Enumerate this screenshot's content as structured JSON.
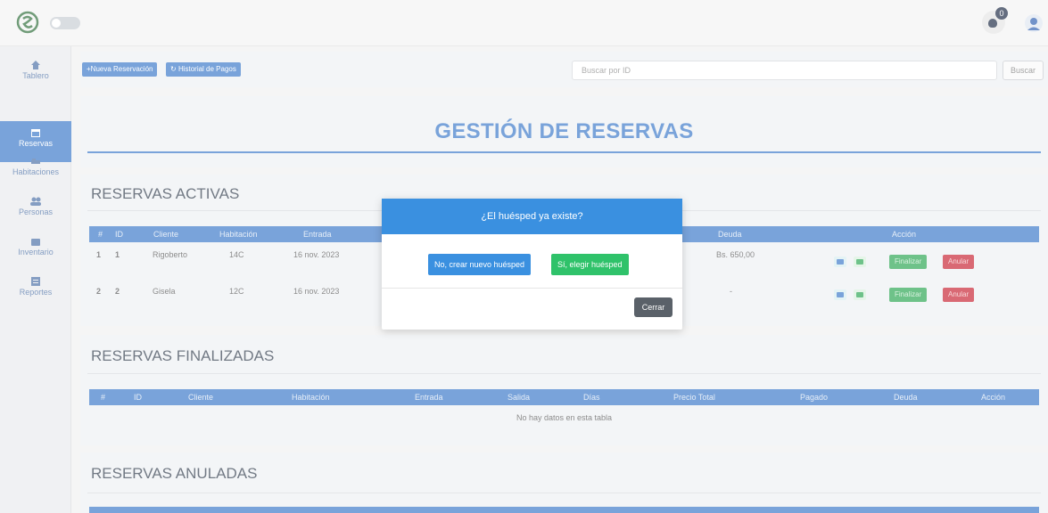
{
  "topbar": {
    "notification_count": "0"
  },
  "sidebar": {
    "items": [
      {
        "label": "Tablero",
        "icon": "home-icon",
        "active": false
      },
      {
        "label": "Reservas",
        "icon": "calendar-icon",
        "active": true
      },
      {
        "label": "Habitaciones",
        "icon": "bed-icon",
        "active": false
      },
      {
        "label": "Personas",
        "icon": "users-icon",
        "active": false
      },
      {
        "label": "Inventario",
        "icon": "box-icon",
        "active": false
      },
      {
        "label": "Reportes",
        "icon": "report-icon",
        "active": false
      }
    ]
  },
  "toolbar": {
    "new_reservation": "+Nueva Reservación",
    "payment_history": "Historial de Pagos",
    "search_placeholder": "Buscar por ID",
    "search_button": "Buscar"
  },
  "page_title": "GESTIÓN DE RESERVAS",
  "active": {
    "title": "RESERVAS ACTIVAS",
    "headers": [
      "#",
      "ID",
      "Cliente",
      "Habitación",
      "Entrada",
      "Deuda",
      "Acción"
    ],
    "rows": [
      {
        "num": "1",
        "id": "1",
        "cliente": "Rigoberto",
        "habitacion": "14C",
        "entrada": "16 nov. 2023",
        "deuda": "Bs. 650,00"
      },
      {
        "num": "2",
        "id": "2",
        "cliente": "Gisela",
        "habitacion": "12C",
        "entrada": "16 nov. 2023",
        "deuda": "-"
      }
    ],
    "finalize_label": "Finalizar",
    "cancel_label": "Anular"
  },
  "finished": {
    "title": "RESERVAS FINALIZADAS",
    "headers": [
      "#",
      "ID",
      "Cliente",
      "Habitación",
      "Entrada",
      "Salida",
      "Días",
      "Precio Total",
      "Pagado",
      "Deuda",
      "Acción"
    ],
    "empty_text": "No hay datos en esta tabla"
  },
  "cancelled": {
    "title": "RESERVAS ANULADAS"
  },
  "modal": {
    "title": "¿El huésped ya existe?",
    "no_button": "No, crear nuevo huésped",
    "yes_button": "Sí, elegir huésped",
    "close_button": "Cerrar"
  },
  "colors": {
    "primary": "#3a78c9",
    "modal_header": "#3a90e0",
    "success": "#2aa551",
    "danger": "#c82333"
  }
}
